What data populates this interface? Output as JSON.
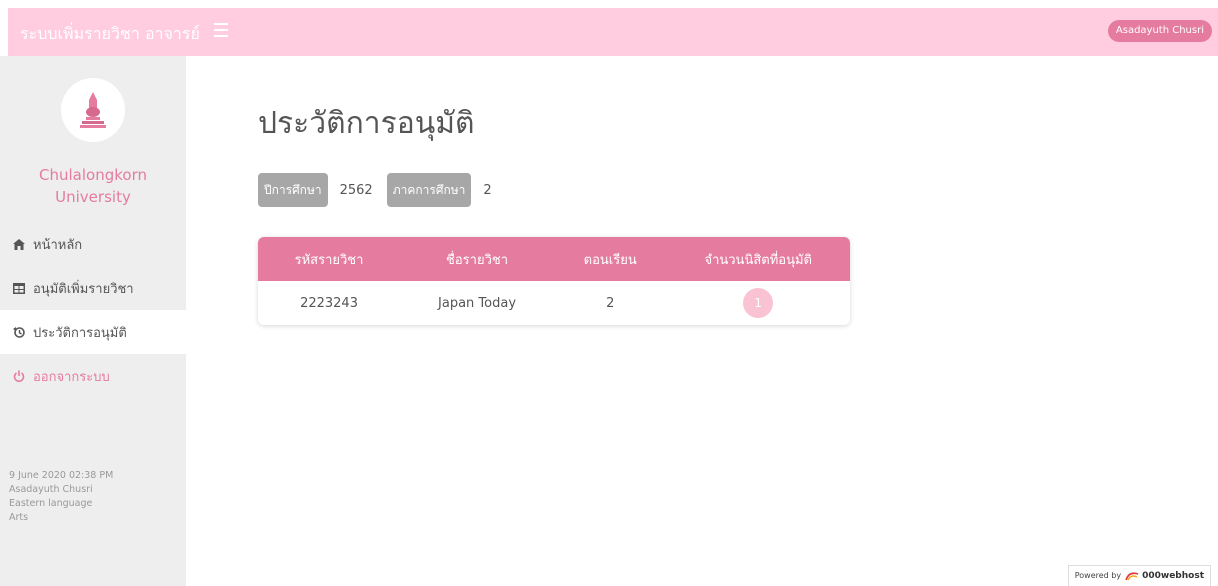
{
  "header": {
    "brand": "ระบบเพิ่มรายวิชา",
    "role": "อาจารย์",
    "user_button": "Asadayuth Chusri"
  },
  "sidebar": {
    "university_line1": "Chulalongkorn",
    "university_line2": "University",
    "items": [
      {
        "label": "หน้าหลัก",
        "icon": "home-icon"
      },
      {
        "label": "อนุมัติเพิ่มรายวิชา",
        "icon": "table-icon"
      },
      {
        "label": "ประวัติการอนุมัติ",
        "icon": "history-icon"
      },
      {
        "label": "ออกจากระบบ",
        "icon": "power-icon"
      }
    ],
    "info": {
      "datetime": "9 June 2020 02:38 PM",
      "name": "Asadayuth Chusri",
      "department": "Eastern language",
      "faculty": "Arts"
    }
  },
  "main": {
    "title": "ประวัติการอนุมัติ",
    "filters": {
      "year_label": "ปีการศึกษา",
      "year_value": "2562",
      "semester_label": "ภาคการศึกษา",
      "semester_value": "2"
    },
    "table": {
      "headers": [
        "รหัสรายวิชา",
        "ชื่อรายวิชา",
        "ตอนเรียน",
        "จำนวนนิสิตที่อนุมัติ"
      ],
      "rows": [
        {
          "code": "2223243",
          "name": "Japan Today",
          "section": "2",
          "approved": "1"
        }
      ]
    }
  },
  "footer": {
    "powered_by": "Powered by",
    "host": "000webhost"
  },
  "colors": {
    "accent": "#e57c9f",
    "topbar": "#ffcce0",
    "sidebar": "#eeeeee",
    "chip": "#a7a7a7",
    "badge": "#f9c3d3"
  }
}
